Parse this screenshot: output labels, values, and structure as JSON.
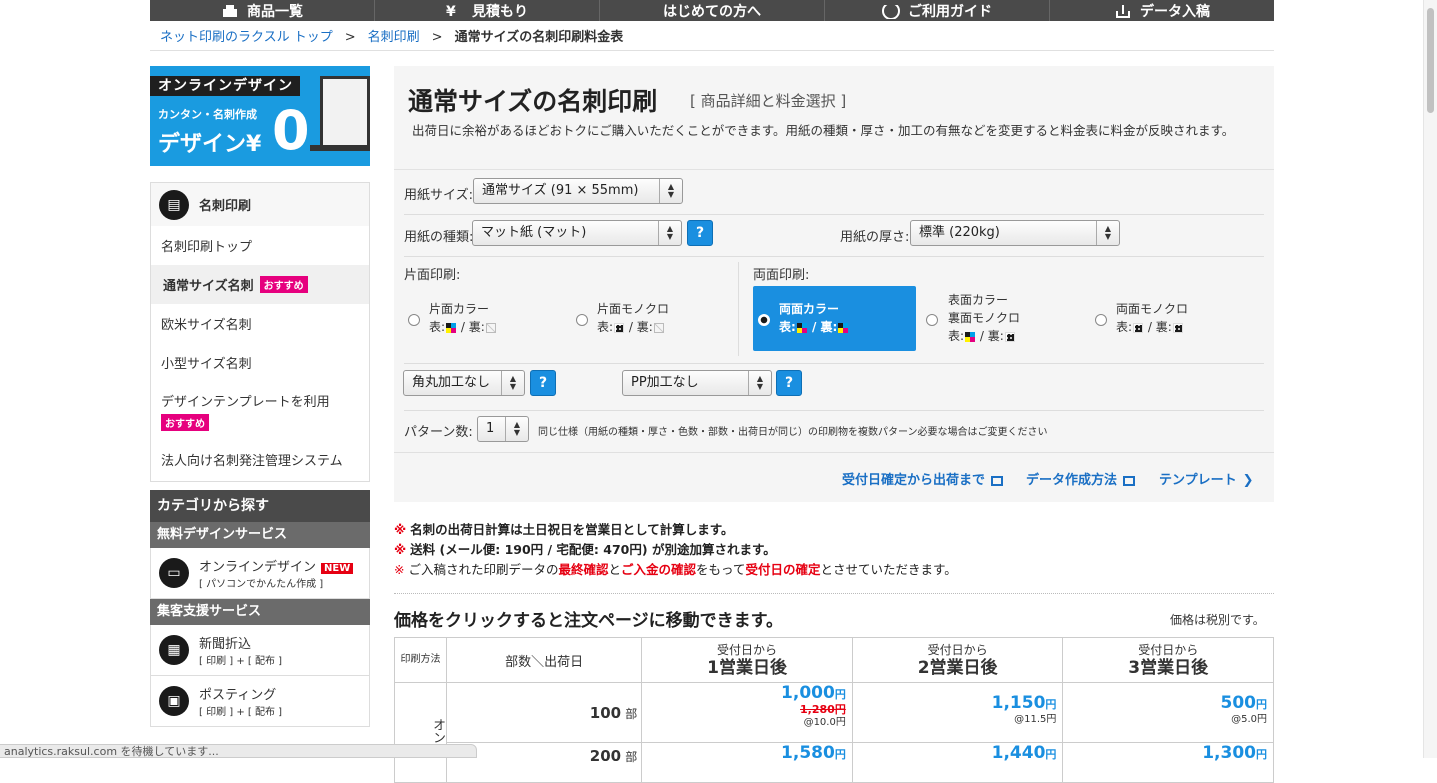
{
  "nav": {
    "items": [
      "商品一覧",
      "見積もり",
      "はじめての方へ",
      "ご利用ガイド",
      "データ入稿"
    ]
  },
  "breadcrumb": {
    "items": [
      "ネット印刷のラクスル トップ",
      "名刺印刷"
    ],
    "current": "通常サイズの名刺印刷料金表",
    "separator": ">"
  },
  "banner": {
    "label": "オンラインデザイン",
    "line1": "カンタン・名刺作成",
    "line2": "デザイン¥",
    "big": "0"
  },
  "sidemenu": {
    "header": "名刺印刷",
    "items": [
      {
        "label": "名刺印刷トップ"
      },
      {
        "label": "通常サイズ名刺",
        "badge": "おすすめ"
      },
      {
        "label": "欧米サイズ名刺"
      },
      {
        "label": "小型サイズ名刺"
      },
      {
        "label": "デザインテンプレートを利用",
        "badge": "おすすめ"
      },
      {
        "label": "法人向け名刺発注管理システム"
      }
    ]
  },
  "category": {
    "header": "カテゴリから探す",
    "sub1": "無料デザインサービス",
    "online_design": {
      "title": "オンラインデザイン",
      "badge": "NEW",
      "sub": "[ パソコンでかんたん作成 ]"
    },
    "sub2": "集客支援サービス",
    "newspaper": {
      "title": "新聞折込",
      "sub": "[ 印刷 ] + [ 配布 ]"
    },
    "posting": {
      "title": "ポスティング",
      "sub": "[ 印刷 ] + [ 配布 ]"
    }
  },
  "status": "analytics.raksul.com を待機しています...",
  "main": {
    "title": "通常サイズの名刺印刷",
    "subtitle": "[ 商品詳細と料金選択 ]",
    "desc": "出荷日に余裕があるほどおトクにご購入いただくことができます。用紙の種類・厚さ・加工の有無などを変更すると料金表に料金が反映されます。",
    "paper_size_label": "用紙サイズ:",
    "paper_size_value": "通常サイズ (91 × 55mm)",
    "paper_type_label": "用紙の種類:",
    "paper_type_value": "マット紙 (マット)",
    "paper_thickness_label": "用紙の厚さ:",
    "paper_thickness_value": "標準 (220kg)",
    "help": "?",
    "single_label": "片面印刷:",
    "double_label": "両面印刷:",
    "options": {
      "single_color": {
        "line1": "片面カラー",
        "front": "表:",
        "back": "/ 裏:"
      },
      "single_mono": {
        "line1": "片面モノクロ",
        "front": "表:",
        "back": "/ 裏:"
      },
      "both_color": {
        "line1": "両面カラー",
        "front": "表:",
        "back": "/ 裏:"
      },
      "front_color_back_mono": {
        "line1": "表面カラー",
        "line2": "裏面モノクロ",
        "front": "表:",
        "back": "/ 裏:"
      },
      "both_mono": {
        "line1": "両面モノクロ",
        "front": "表:",
        "back": "/ 裏:"
      }
    },
    "corner_value": "角丸加工なし",
    "pp_value": "PP加工なし",
    "pattern_label": "パターン数:",
    "pattern_value": "1",
    "pattern_note": "同じ仕様（用紙の種類・厚さ・色数・部数・出荷日が同じ）の印刷物を複数パターン必要な場合はご変更ください",
    "links": {
      "ship": "受付日確定から出荷まで",
      "data": "データ作成方法",
      "template": "テンプレート"
    }
  },
  "notes": {
    "n1_a": "名刺の出荷日計算は土日祝日を営業日として計算します。",
    "n2_a": "送料 (メール便: 190円 / 宅配便: 470円) が別途加算されます。",
    "n3_a": "ご入稿された印刷データの",
    "n3_b": "最終確認",
    "n3_c": "と",
    "n3_d": "ご入金の確認",
    "n3_e": "をもって",
    "n3_f": "受付日の確定",
    "n3_g": "とさせていただきます。",
    "ast": "※"
  },
  "price": {
    "heading": "価格をクリックすると注文ページに移動できます。",
    "tax": "価格は税別です。",
    "col_method": "印刷方法",
    "col_qty": "部数＼出荷日",
    "col_prefix": "受付日から",
    "days": [
      "1営業日後",
      "2営業日後",
      "3営業日後"
    ],
    "row_method": "オンデ",
    "rows": [
      {
        "qty": "100",
        "unit": "部",
        "cells": [
          {
            "price": "1,000",
            "yen": "円",
            "orig": "1,280円",
            "per": "@10.0円"
          },
          {
            "price": "1,150",
            "yen": "円",
            "per": "@11.5円"
          },
          {
            "price": "500",
            "yen": "円",
            "per": "@5.0円"
          }
        ]
      },
      {
        "qty": "200",
        "unit": "部",
        "cells": [
          {
            "price": "1,580",
            "yen": "円"
          },
          {
            "price": "1,440",
            "yen": "円"
          },
          {
            "price": "1,300",
            "yen": "円"
          }
        ]
      }
    ]
  }
}
